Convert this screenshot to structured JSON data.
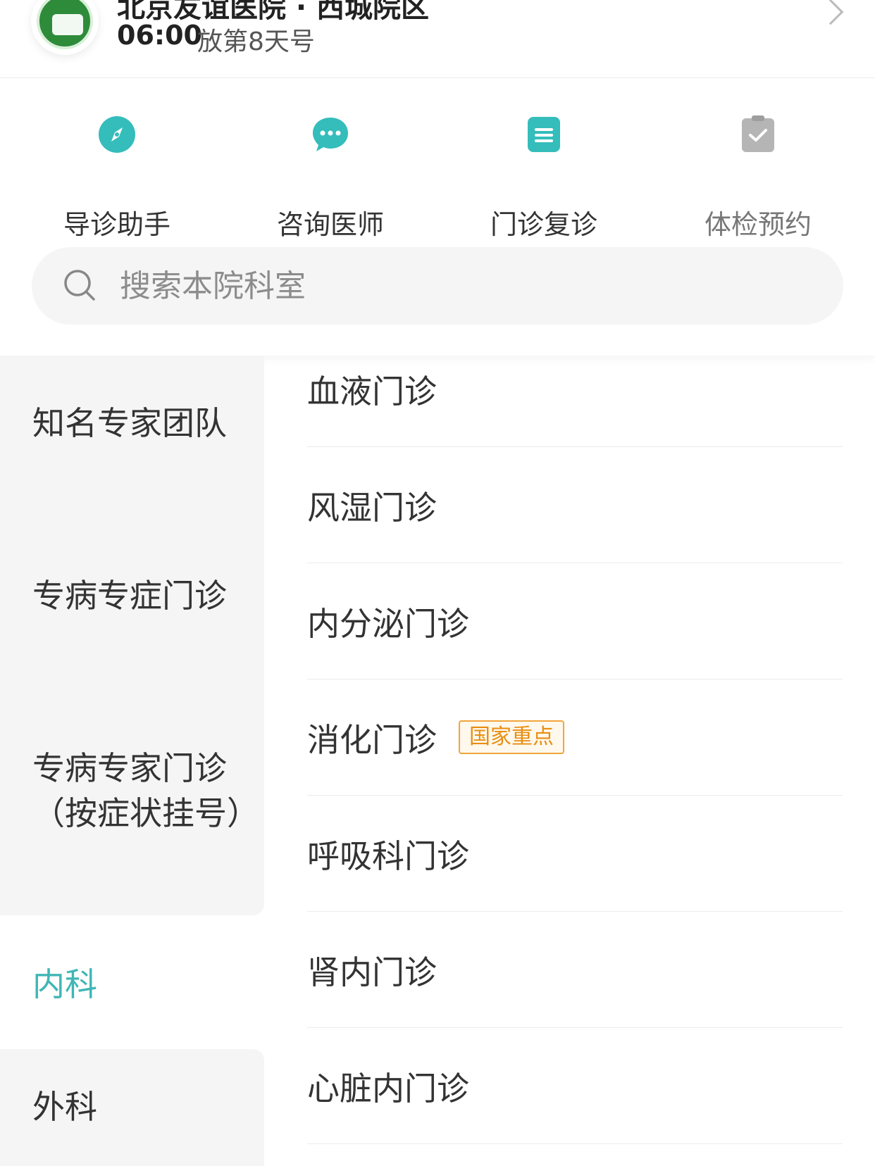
{
  "header": {
    "hospital_name": "北京友谊医院 · 西城院区",
    "release_time": "06:00",
    "release_note": "放第8天号"
  },
  "shortcuts": [
    {
      "label": "导诊助手",
      "icon": "compass-icon",
      "color": "#34bdbb"
    },
    {
      "label": "咨询医师",
      "icon": "chat-bubble-icon",
      "color": "#34bdbb"
    },
    {
      "label": "门诊复诊",
      "icon": "document-list-icon",
      "color": "#34bdbb"
    },
    {
      "label": "体检预约",
      "icon": "clipboard-check-icon",
      "color": "#b5b5b5"
    }
  ],
  "search": {
    "placeholder": "搜索本院科室"
  },
  "sidebar": {
    "items": [
      {
        "label": "知名专家团队",
        "active": false
      },
      {
        "label": "专病专症门诊",
        "active": false
      },
      {
        "label": "专病专家门诊（按症状挂号）",
        "active": false
      },
      {
        "label": "内科",
        "active": true
      },
      {
        "label": "外科",
        "active": false
      }
    ]
  },
  "departments": [
    {
      "name": "血液门诊"
    },
    {
      "name": "风湿门诊"
    },
    {
      "name": "内分泌门诊"
    },
    {
      "name": "消化门诊",
      "badge": "国家重点"
    },
    {
      "name": "呼吸科门诊"
    },
    {
      "name": "肾内门诊"
    },
    {
      "name": "心脏内门诊"
    }
  ],
  "colors": {
    "accent": "#3fb6b5",
    "badge_border": "#f1a53b",
    "badge_text": "#e88e12",
    "sidebar_bg": "#f5f5f5"
  }
}
